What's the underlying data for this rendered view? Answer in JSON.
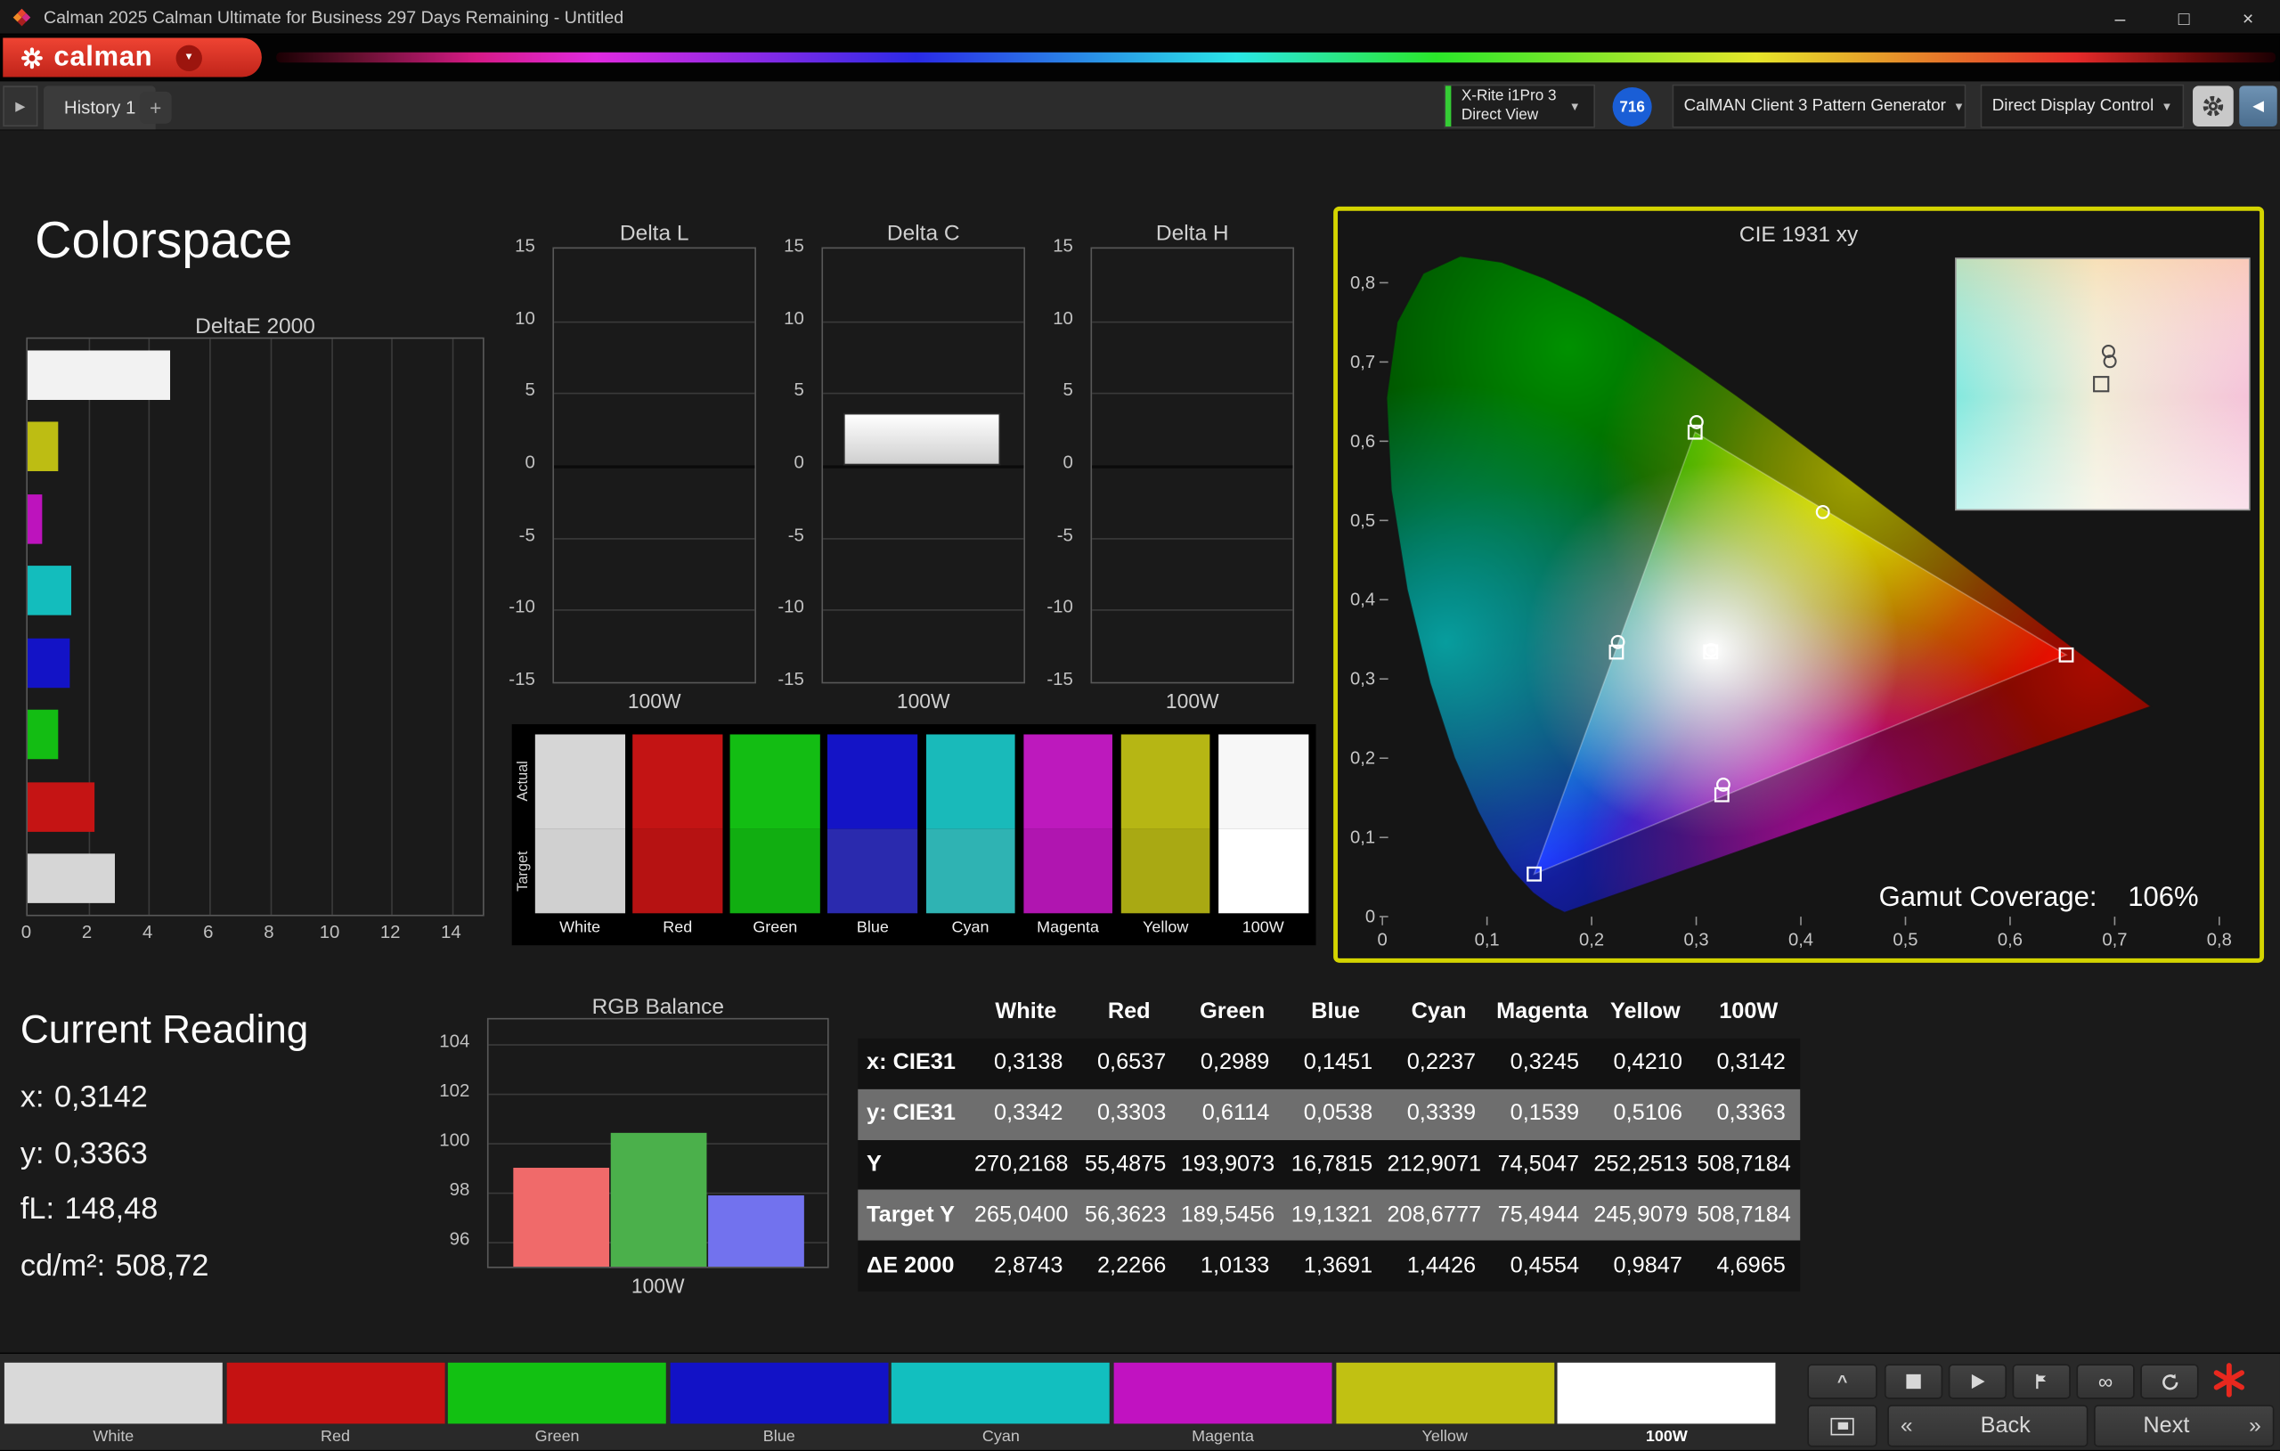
{
  "window": {
    "title": "Calman 2025 Calman Ultimate for Business 297 Days Remaining  - Untitled",
    "controls": {
      "minimize": "–",
      "maximize": "□",
      "close": "×"
    }
  },
  "brand": {
    "wordmark": "calman"
  },
  "toolbar": {
    "history_tab": "History 1",
    "add_tab": "+",
    "meter": {
      "line1": "X-Rite i1Pro 3",
      "line2": "Direct View"
    },
    "badge": "716",
    "pattern_generator": "CalMAN Client 3 Pattern Generator",
    "display_control": "Direct Display Control"
  },
  "page": {
    "title": "Colorspace"
  },
  "current_reading": {
    "title": "Current Reading",
    "lines": [
      {
        "label": "x:",
        "value": "0,3142"
      },
      {
        "label": "y:",
        "value": "0,3363"
      },
      {
        "label": "fL:",
        "value": "148,48"
      },
      {
        "label": "cd/m²:",
        "value": "508,72"
      }
    ]
  },
  "swatch_strip": {
    "row_labels": [
      "Actual",
      "Target"
    ],
    "columns": [
      {
        "label": "White",
        "actual": "#d6d6d6",
        "target": "#d0d0d0"
      },
      {
        "label": "Red",
        "actual": "#c31414",
        "target": "#b61212"
      },
      {
        "label": "Green",
        "actual": "#13bd13",
        "target": "#11ae11"
      },
      {
        "label": "Blue",
        "actual": "#1414c6",
        "target": "#2a2aae"
      },
      {
        "label": "Cyan",
        "actual": "#19baba",
        "target": "#2fb3b3"
      },
      {
        "label": "Magenta",
        "actual": "#bd19bd",
        "target": "#b015b0"
      },
      {
        "label": "Yellow",
        "actual": "#b6b614",
        "target": "#a9a913"
      },
      {
        "label": "100W",
        "actual": "#f7f7f7",
        "target": "#ffffff"
      }
    ]
  },
  "bottom_bar": {
    "patches": [
      {
        "label": "White",
        "color": "#d9d9d9",
        "selected": false
      },
      {
        "label": "Red",
        "color": "#c51212",
        "selected": false
      },
      {
        "label": "Green",
        "color": "#12c112",
        "selected": false
      },
      {
        "label": "Blue",
        "color": "#1212c6",
        "selected": false
      },
      {
        "label": "Cyan",
        "color": "#12bfbf",
        "selected": false
      },
      {
        "label": "Magenta",
        "color": "#c112c1",
        "selected": false
      },
      {
        "label": "Yellow",
        "color": "#c1c112",
        "selected": false
      },
      {
        "label": "100W",
        "color": "#ffffff",
        "selected": true
      }
    ],
    "back_label": "Back",
    "next_label": "Next",
    "back_chevron": "«",
    "next_chevron": "»"
  },
  "icons": {
    "dropdown_arrow": "▼",
    "nav_left": "◀",
    "nav_right": "▶",
    "caret_up": "^",
    "infinity": "∞"
  },
  "chart_data": [
    {
      "id": "deltae2000",
      "type": "bar",
      "orientation": "horizontal",
      "title": "DeltaE 2000",
      "categories": [
        "100W",
        "Yellow",
        "Magenta",
        "Cyan",
        "Blue",
        "Green",
        "Red",
        "White"
      ],
      "values": [
        4.6965,
        0.9847,
        0.4554,
        1.4426,
        1.3691,
        1.0133,
        2.2266,
        2.8743
      ],
      "bar_colors": [
        "#f2f2f2",
        "#bdbd13",
        "#bd13bd",
        "#13bdbd",
        "#1313c6",
        "#13bd13",
        "#c51414",
        "#d6d6d6"
      ],
      "xlim": [
        0,
        15
      ],
      "xticks": [
        0,
        2,
        4,
        6,
        8,
        10,
        12,
        14
      ],
      "grid": true
    },
    {
      "id": "delta_l",
      "type": "bar",
      "title": "Delta L",
      "categories": [
        "100W"
      ],
      "values": [
        0
      ],
      "ylim": [
        -15,
        15
      ],
      "yticks": [
        15,
        10,
        5,
        0,
        -5,
        -10,
        -15
      ],
      "xlabel": "100W"
    },
    {
      "id": "delta_c",
      "type": "bar",
      "title": "Delta C",
      "categories": [
        "100W"
      ],
      "values": [
        3.6
      ],
      "ylim": [
        -15,
        15
      ],
      "yticks": [
        15,
        10,
        5,
        0,
        -5,
        -10,
        -15
      ],
      "xlabel": "100W"
    },
    {
      "id": "delta_h",
      "type": "bar",
      "title": "Delta H",
      "categories": [
        "100W"
      ],
      "values": [
        0
      ],
      "ylim": [
        -15,
        15
      ],
      "yticks": [
        15,
        10,
        5,
        0,
        -5,
        -10,
        -15
      ],
      "xlabel": "100W"
    },
    {
      "id": "rgb_balance",
      "type": "bar",
      "title": "RGB Balance",
      "categories": [
        "Red",
        "Green",
        "Blue"
      ],
      "values": [
        99.0,
        100.4,
        97.9
      ],
      "bar_colors": [
        "#f06a6a",
        "#4bb04b",
        "#7272ee"
      ],
      "ylim": [
        95,
        105
      ],
      "yticks": [
        104,
        102,
        100,
        98,
        96
      ],
      "xlabel": "100W"
    },
    {
      "id": "cie1931",
      "type": "scatter",
      "title": "CIE 1931 xy",
      "xlim": [
        0,
        0.8
      ],
      "ylim": [
        0,
        0.8
      ],
      "xtick_labels": [
        "0",
        "0,1",
        "0,2",
        "0,3",
        "0,4",
        "0,5",
        "0,6",
        "0,7",
        "0,8"
      ],
      "ytick_labels": [
        "0",
        "0,1",
        "0,2",
        "0,3",
        "0,4",
        "0,5",
        "0,6",
        "0,7",
        "0,8"
      ],
      "gamut_coverage_label": "Gamut Coverage:",
      "gamut_coverage_value": "106%",
      "points": [
        {
          "name": "White",
          "x": 0.3138,
          "y": 0.3342,
          "marker": "square"
        },
        {
          "name": "Red",
          "x": 0.6537,
          "y": 0.3303,
          "marker": "square"
        },
        {
          "name": "Green",
          "x": 0.2989,
          "y": 0.6114,
          "marker": "circle-square"
        },
        {
          "name": "Blue",
          "x": 0.1451,
          "y": 0.0538,
          "marker": "square"
        },
        {
          "name": "Cyan",
          "x": 0.2237,
          "y": 0.3339,
          "marker": "circle-square"
        },
        {
          "name": "Magenta",
          "x": 0.3245,
          "y": 0.1539,
          "marker": "circle-square"
        },
        {
          "name": "Yellow",
          "x": 0.421,
          "y": 0.5106,
          "marker": "circle"
        },
        {
          "name": "100W",
          "x": 0.3142,
          "y": 0.3363,
          "marker": "circle"
        }
      ],
      "triangle": [
        [
          0.6537,
          0.3303
        ],
        [
          0.2989,
          0.6114
        ],
        [
          0.1451,
          0.0538
        ]
      ],
      "locus": [
        [
          0.1741,
          0.005
        ],
        [
          0.1689,
          0.0086
        ],
        [
          0.1644,
          0.0109
        ],
        [
          0.1566,
          0.0177
        ],
        [
          0.144,
          0.0297
        ],
        [
          0.1241,
          0.0578
        ],
        [
          0.1096,
          0.0868
        ],
        [
          0.0913,
          0.1327
        ],
        [
          0.0687,
          0.2007
        ],
        [
          0.0454,
          0.295
        ],
        [
          0.0235,
          0.4127
        ],
        [
          0.0082,
          0.5384
        ],
        [
          0.0039,
          0.6548
        ],
        [
          0.0139,
          0.7502
        ],
        [
          0.0389,
          0.812
        ],
        [
          0.0743,
          0.8338
        ],
        [
          0.1142,
          0.8262
        ],
        [
          0.1547,
          0.8059
        ],
        [
          0.1929,
          0.7816
        ],
        [
          0.2296,
          0.7543
        ],
        [
          0.2658,
          0.7243
        ],
        [
          0.3016,
          0.6923
        ],
        [
          0.3373,
          0.6588
        ],
        [
          0.3731,
          0.6245
        ],
        [
          0.4087,
          0.5896
        ],
        [
          0.4441,
          0.5547
        ],
        [
          0.4784,
          0.5202
        ],
        [
          0.5125,
          0.4866
        ],
        [
          0.5448,
          0.4544
        ],
        [
          0.5752,
          0.4242
        ],
        [
          0.6029,
          0.3965
        ],
        [
          0.627,
          0.3725
        ],
        [
          0.6482,
          0.3514
        ],
        [
          0.6658,
          0.334
        ],
        [
          0.6801,
          0.3197
        ],
        [
          0.6915,
          0.3083
        ],
        [
          0.7079,
          0.292
        ],
        [
          0.719,
          0.2809
        ],
        [
          0.726,
          0.274
        ],
        [
          0.7347,
          0.2653
        ]
      ],
      "inset": {
        "markers": [
          {
            "type": "circle",
            "fx": 0.52,
            "fy": 0.37
          },
          {
            "type": "circle",
            "fx": 0.525,
            "fy": 0.41
          },
          {
            "type": "square",
            "fx": 0.495,
            "fy": 0.5
          }
        ]
      }
    },
    {
      "id": "readings_table",
      "type": "table",
      "columns": [
        "White",
        "Red",
        "Green",
        "Blue",
        "Cyan",
        "Magenta",
        "Yellow",
        "100W"
      ],
      "rows": [
        {
          "label": "x: CIE31",
          "shade": "dark",
          "values": [
            "0,3138",
            "0,6537",
            "0,2989",
            "0,1451",
            "0,2237",
            "0,3245",
            "0,4210",
            "0,3142"
          ]
        },
        {
          "label": "y: CIE31",
          "shade": "gray",
          "values": [
            "0,3342",
            "0,3303",
            "0,6114",
            "0,0538",
            "0,3339",
            "0,1539",
            "0,5106",
            "0,3363"
          ]
        },
        {
          "label": "Y",
          "shade": "dark",
          "values": [
            "270,2168",
            "55,4875",
            "193,9073",
            "16,7815",
            "212,9071",
            "74,5047",
            "252,2513",
            "508,7184"
          ]
        },
        {
          "label": "Target Y",
          "shade": "gray",
          "values": [
            "265,0400",
            "56,3623",
            "189,5456",
            "19,1321",
            "208,6777",
            "75,4944",
            "245,9079",
            "508,7184"
          ]
        },
        {
          "label": "ΔE 2000",
          "shade": "dark",
          "values": [
            "2,8743",
            "2,2266",
            "1,0133",
            "1,3691",
            "1,4426",
            "0,4554",
            "0,9847",
            "4,6965"
          ]
        }
      ]
    }
  ]
}
